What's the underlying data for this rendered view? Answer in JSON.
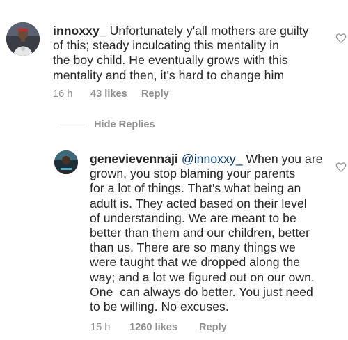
{
  "comments": [
    {
      "username": "innoxxy_",
      "text": "Unfortunately y'all mothers are guilty of this; steady inculcating this mentality in the boy child. He eventually grows with this mentality and then, it's hard to change him",
      "line1_rest": " Unfortunately y'all mothers are guilty",
      "line2": "of this; steady inculcating this mentality in",
      "line3": "the boy child. He eventually grows with this",
      "line4": "mentality and then, it's hard to change him",
      "time": "16 h",
      "likes": "43 likes",
      "reply_label": "Reply",
      "avatar_icon": "profile-photo-icon",
      "like_icon": "heart-outline-icon"
    },
    {
      "username": "genevievennaji",
      "mention": "@innoxxy_",
      "line1_rest": " When you are",
      "line2": "grown, you stop blaming your parents",
      "line3": "for a lot of things. That's what being an",
      "line4": "adult is. They acted based on their level",
      "line5": "of understanding. We are meant to be",
      "line6": "better than them and our children, better",
      "line7": "than us. There are so many things we",
      "line8": "were taught that we dropped along the",
      "line9": "way; and a lot we figured out on our own.",
      "line10": "One  can always do better. You just need",
      "line11": "to be willing. No excuses.",
      "time": "15 h",
      "likes": "1260 likes",
      "reply_label": "Reply",
      "avatar_icon": "profile-photo-icon",
      "like_icon": "heart-outline-icon"
    }
  ],
  "hide_replies_label": "Hide Replies",
  "colors": {
    "text": "#262626",
    "meta": "#8e8e8e",
    "mention": "#00376b",
    "heart": "#8e8e8e"
  }
}
